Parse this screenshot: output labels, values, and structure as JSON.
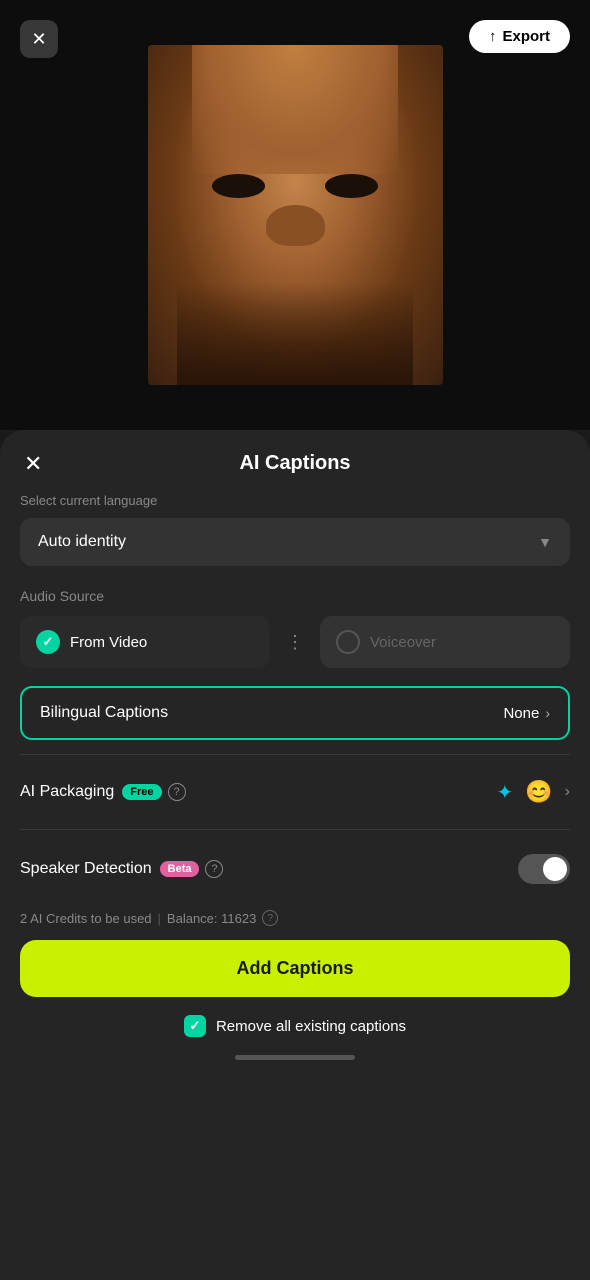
{
  "video": {
    "close_label": "✕",
    "export_label": "Export",
    "export_icon": "↑"
  },
  "panel": {
    "close_label": "✕",
    "title": "AI Captions",
    "language_section_label": "Select current language",
    "language_selected": "Auto identity",
    "audio_section_label": "Audio Source",
    "audio_from_video_label": "From Video",
    "audio_voiceover_label": "Voiceover",
    "bilingual_label": "Bilingual Captions",
    "bilingual_value": "None",
    "ai_packaging_label": "AI Packaging",
    "ai_packaging_badge": "Free",
    "speaker_detection_label": "Speaker Detection",
    "speaker_detection_badge": "Beta",
    "credits_text": "2 AI Credits to be used",
    "balance_label": "Balance: 11623",
    "add_captions_label": "Add Captions",
    "remove_captions_label": "Remove all existing captions"
  }
}
